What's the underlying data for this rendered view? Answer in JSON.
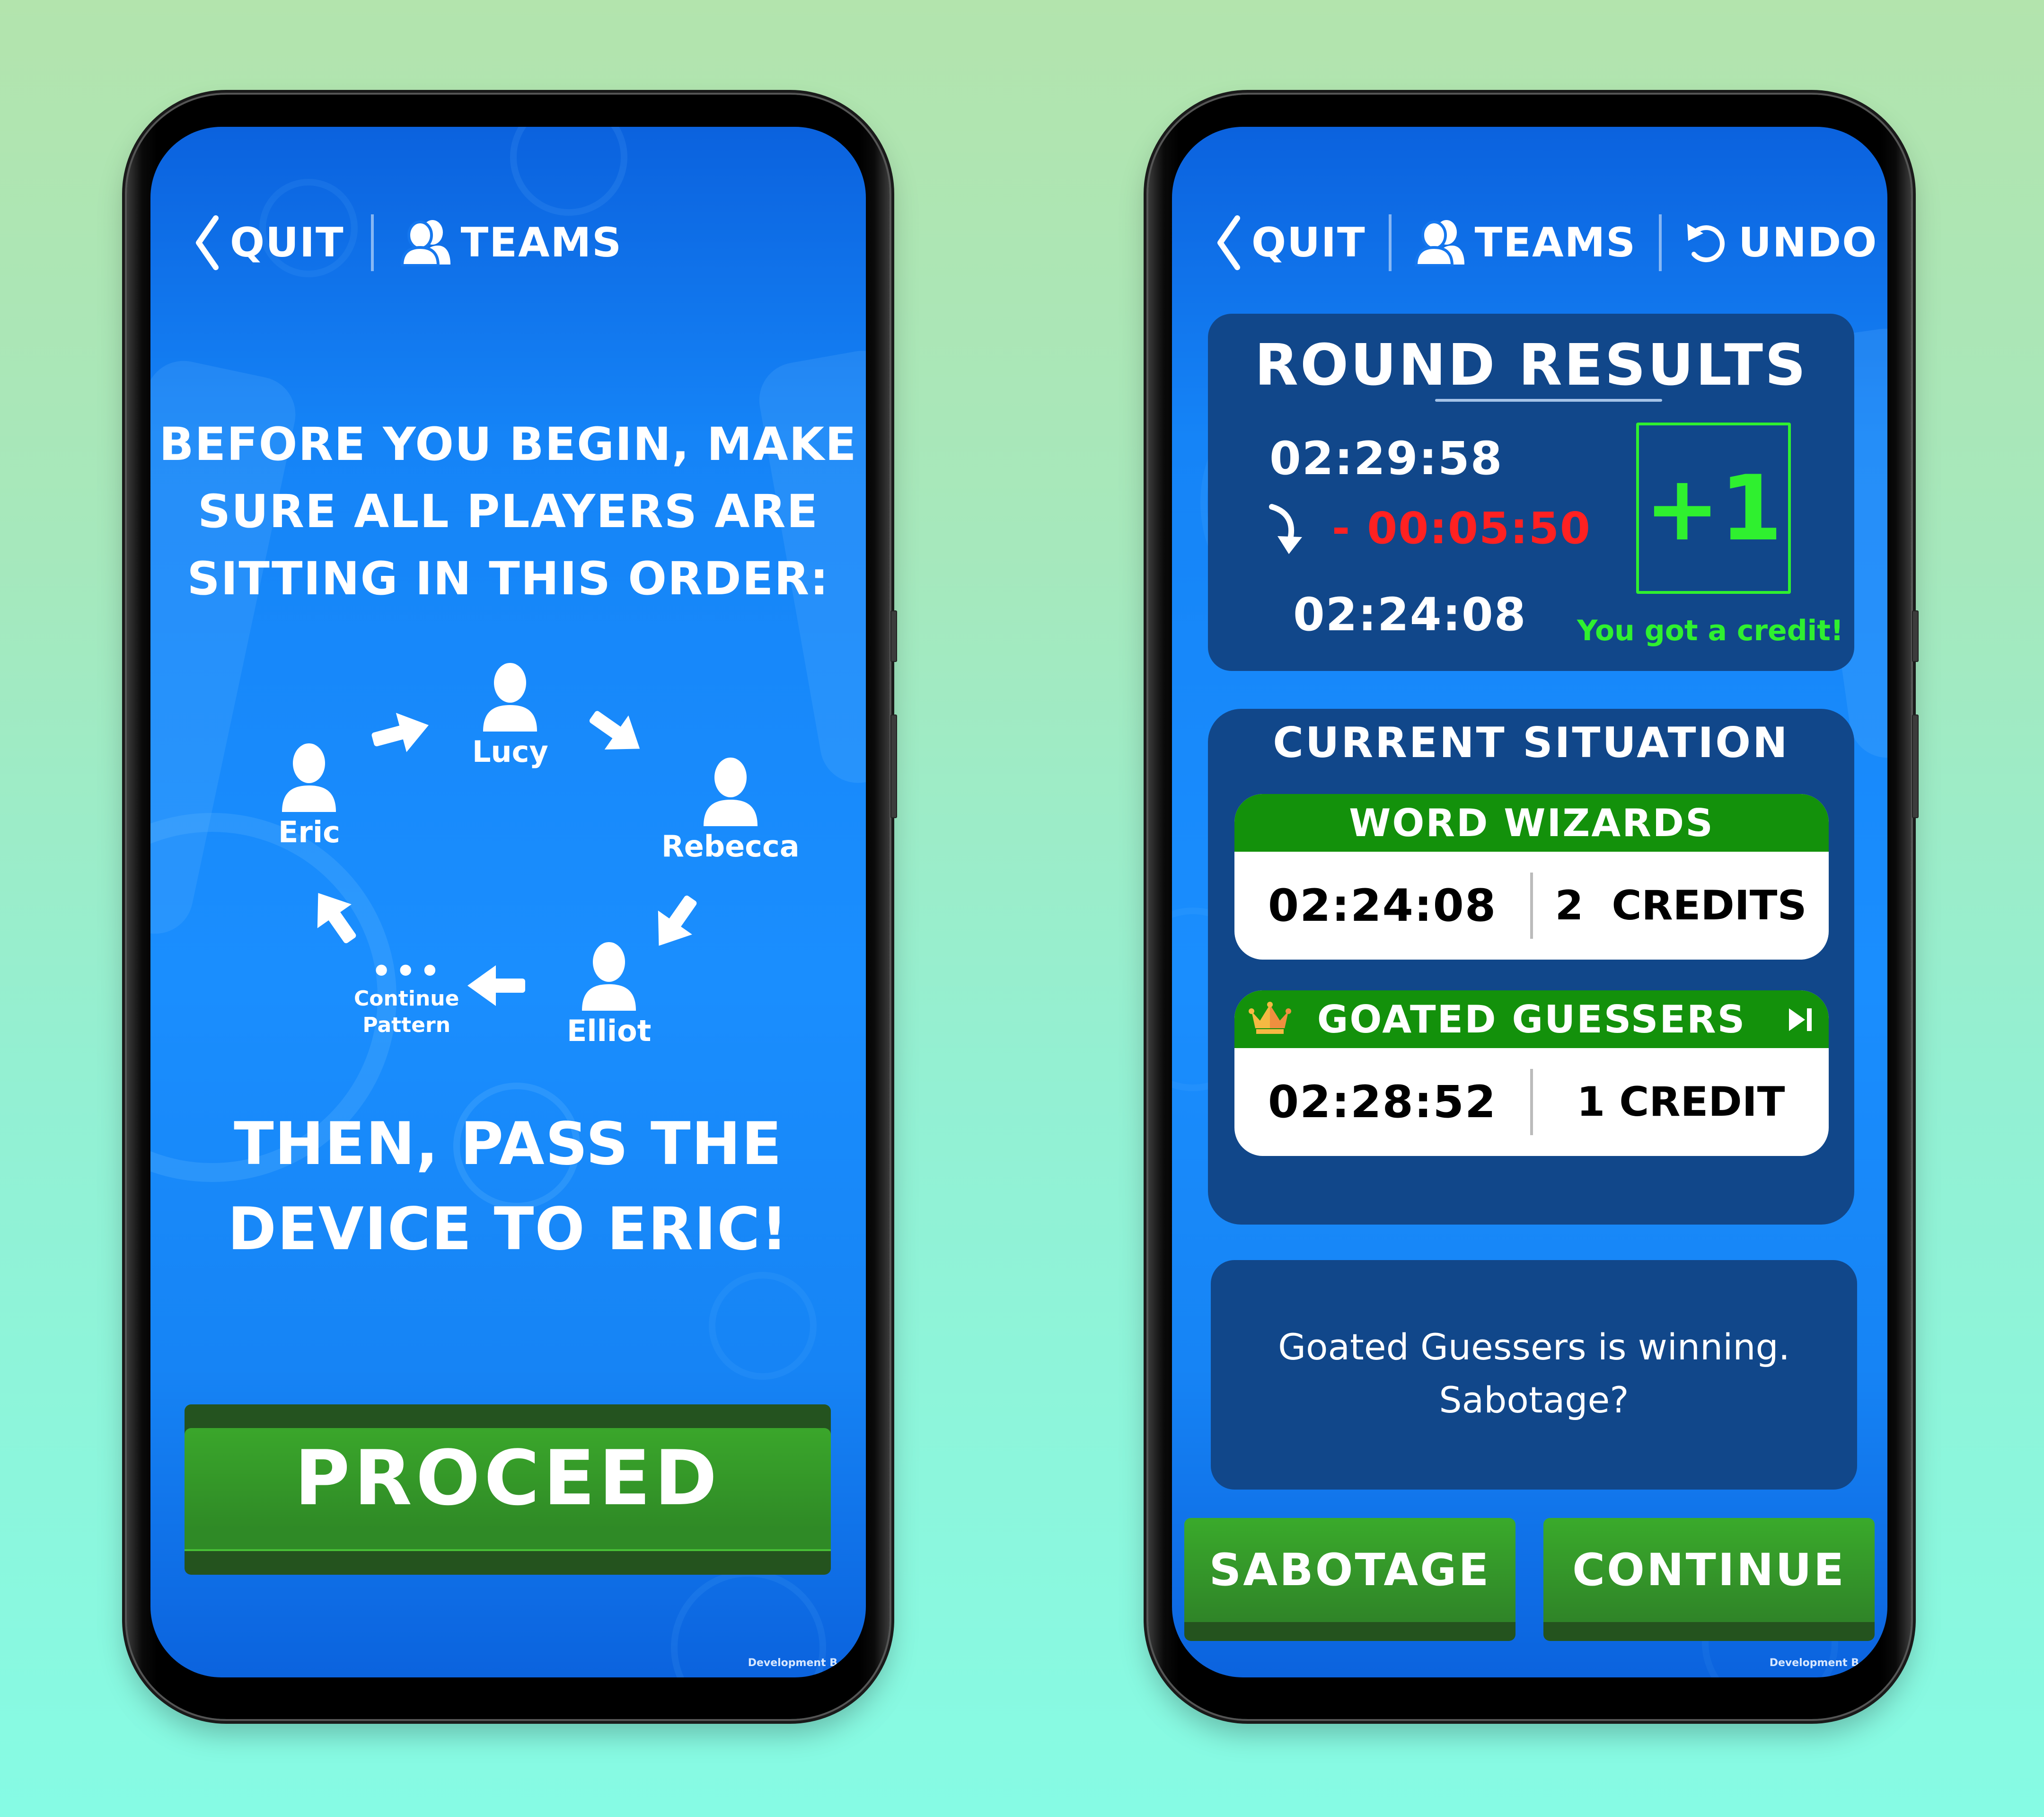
{
  "left_screen": {
    "nav": {
      "quit_label": "QUIT",
      "teams_label": "TEAMS",
      "quit_icon": "chevron-left-icon",
      "teams_icon": "users-icon"
    },
    "instruction_top": [
      "BEFORE YOU BEGIN, MAKE",
      "SURE ALL PLAYERS ARE",
      "SITTING IN THIS ORDER:"
    ],
    "seating_order": [
      {
        "name": "Eric"
      },
      {
        "name": "Lucy"
      },
      {
        "name": "Rebecca"
      },
      {
        "name": "Elliot"
      }
    ],
    "continue_pattern": {
      "dots": "•••",
      "line1": "Continue",
      "line2": "Pattern"
    },
    "instruction_bottom": [
      "THEN, PASS THE",
      "DEVICE TO ERIC!"
    ],
    "proceed_label": "PROCEED",
    "dev_label": "Development B"
  },
  "right_screen": {
    "nav": {
      "quit_label": "QUIT",
      "teams_label": "TEAMS",
      "undo_label": "UNDO",
      "quit_icon": "chevron-left-icon",
      "teams_icon": "users-icon",
      "undo_icon": "undo-icon"
    },
    "round_results": {
      "title": "ROUND RESULTS",
      "start_time": "02:29:58",
      "deduction": "- 00:05:50",
      "end_time": "02:24:08",
      "credit_delta": "+1",
      "credit_message": "You got a credit!"
    },
    "current_situation": {
      "title": "CURRENT SITUATION",
      "teams": [
        {
          "name": "WORD WIZARDS",
          "time": "02:24:08",
          "credits": "2  CREDITS",
          "leader": false,
          "current": false
        },
        {
          "name": "GOATED GUESSERS",
          "time": "02:28:52",
          "credits": "1 CREDIT",
          "leader": true,
          "current": true
        }
      ]
    },
    "message": [
      "Goated Guessers is winning.",
      "Sabotage?"
    ],
    "sabotage_label": "SABOTAGE",
    "continue_label": "CONTINUE",
    "dev_label": "Development B"
  },
  "colors": {
    "screen_blue": "#1a8efe",
    "panel_navy": "#11478a",
    "button_green": "#3aaa2b",
    "team_header_green": "#13910b",
    "credit_green": "#2ff02f",
    "deduction_red": "#ff2121",
    "crown_gold": "#f5b942"
  }
}
